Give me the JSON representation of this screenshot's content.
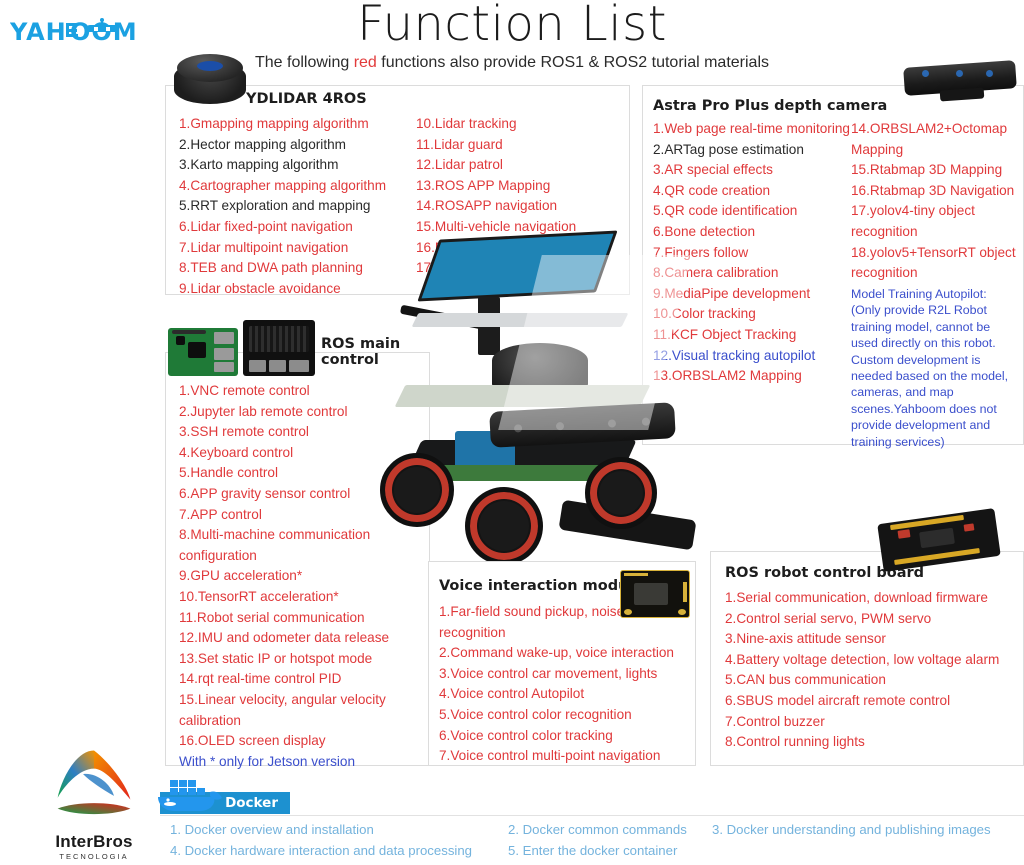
{
  "brand": {
    "logo_text": "YAHBOOM",
    "footer_logo_name": "InterBros",
    "footer_logo_sub": "TECNOLOGIA"
  },
  "header": {
    "title": "Function List",
    "subtitle_before": "The following ",
    "subtitle_highlight": "red",
    "subtitle_after": " functions also provide ROS1 & ROS2 tutorial materials",
    "highlight_color": "#e23b3b"
  },
  "colors": {
    "red": "#e0393b",
    "blue": "#3b4fcc",
    "docker_blue": "#1d91d0",
    "docker_text": "#74b3dd",
    "panel_border": "#dcdcdc"
  },
  "panels": {
    "lidar": {
      "title": "YDLIDAR 4ROS",
      "icon": "lidar-puck-photo",
      "column_left": [
        {
          "text": "1.Gmapping mapping algorithm",
          "color": "red"
        },
        {
          "text": "2.Hector mapping algorithm",
          "color": "black"
        },
        {
          "text": "3.Karto mapping algorithm",
          "color": "black"
        },
        {
          "text": "4.Cartographer mapping algorithm",
          "color": "red"
        },
        {
          "text": "5.RRT exploration and mapping",
          "color": "black"
        },
        {
          "text": "6.Lidar fixed-point navigation",
          "color": "red"
        },
        {
          "text": "7.Lidar multipoint navigation",
          "color": "red"
        },
        {
          "text": "8.TEB and DWA path planning",
          "color": "red"
        },
        {
          "text": "9.Lidar obstacle avoidance",
          "color": "red"
        }
      ],
      "column_right": [
        {
          "text": "10.Lidar tracking",
          "color": "red"
        },
        {
          "text": "11.Lidar guard",
          "color": "red"
        },
        {
          "text": "12.Lidar patrol",
          "color": "red"
        },
        {
          "text": "13.ROS APP Mapping",
          "color": "red"
        },
        {
          "text": "14.ROSAPP navigation",
          "color": "red"
        },
        {
          "text": "15.Multi-vehicle navigation",
          "color": "red"
        },
        {
          "text": "16.Multi-vehicle formation",
          "color": "red"
        },
        {
          "text": "17.Multi-vehicle surround",
          "color": "red"
        }
      ]
    },
    "camera": {
      "title": "Astra Pro Plus depth camera",
      "icon": "depth-camera-photo",
      "column_left": [
        {
          "text": "1.Web page real-time monitoring",
          "color": "red"
        },
        {
          "text": "2.ARTag pose estimation",
          "color": "black"
        },
        {
          "text": "3.AR special effects",
          "color": "red"
        },
        {
          "text": "4.QR code creation",
          "color": "red"
        },
        {
          "text": "5.QR code identification",
          "color": "red"
        },
        {
          "text": "6.Bone detection",
          "color": "red"
        },
        {
          "text": "7.Fingers follow",
          "color": "red"
        },
        {
          "text": "8.Camera calibration",
          "color": "red"
        },
        {
          "text": "9.MediaPipe development",
          "color": "red"
        },
        {
          "text": "10.Color tracking",
          "color": "red"
        },
        {
          "text": "11.KCF Object Tracking",
          "color": "red"
        },
        {
          "text": "12.Visual tracking autopilot",
          "color": "blue"
        },
        {
          "text": "13.ORBSLAM2 Mapping",
          "color": "red"
        }
      ],
      "column_right": [
        {
          "text": "14.ORBSLAM2+Octomap Mapping",
          "color": "red"
        },
        {
          "text": "15.Rtabmap 3D Mapping",
          "color": "red"
        },
        {
          "text": "16.Rtabmap 3D Navigation",
          "color": "red"
        },
        {
          "text": "17.yolov4-tiny object recognition",
          "color": "red"
        },
        {
          "text": "18.yolov5+TensorRT object recognition",
          "color": "red"
        }
      ],
      "note": "Model Training Autopilot: (Only provide R2L Robot training model, cannot be used directly on this robot. Custom development is needed based on the model, cameras, and map scenes.Yahboom does not provide development and training services)"
    },
    "main_control": {
      "title": "ROS main control",
      "icon_a": "raspberry-pi-board-photo",
      "icon_b": "jetson-board-photo",
      "items": [
        {
          "text": "1.VNC remote control",
          "color": "red"
        },
        {
          "text": "2.Jupyter lab remote control",
          "color": "red"
        },
        {
          "text": "3.SSH remote control",
          "color": "red"
        },
        {
          "text": "4.Keyboard control",
          "color": "red"
        },
        {
          "text": "5.Handle control",
          "color": "red"
        },
        {
          "text": "6.APP gravity sensor control",
          "color": "red"
        },
        {
          "text": "7.APP control",
          "color": "red"
        },
        {
          "text": "8.Multi-machine communication configuration",
          "color": "red"
        },
        {
          "text": "9.GPU acceleration*",
          "color": "red"
        },
        {
          "text": "10.TensorRT acceleration*",
          "color": "red"
        },
        {
          "text": "11.Robot serial communication",
          "color": "red"
        },
        {
          "text": "12.IMU and odometer data release",
          "color": "red"
        },
        {
          "text": "13.Set static IP or hotspot mode",
          "color": "red"
        },
        {
          "text": "14.rqt real-time control PID",
          "color": "red"
        },
        {
          "text": "15.Linear velocity, angular velocity calibration",
          "color": "red"
        },
        {
          "text": "16.OLED screen display",
          "color": "red"
        },
        {
          "text": "With * only for Jetson version",
          "color": "blue"
        }
      ]
    },
    "voice": {
      "title": "Voice interaction module",
      "icon": "voice-module-board-photo",
      "items": [
        {
          "text": "1.Far-field sound pickup, noise reduction recognition",
          "color": "red"
        },
        {
          "text": "2.Command wake-up, voice interaction",
          "color": "red"
        },
        {
          "text": "3.Voice control car movement, lights",
          "color": "red"
        },
        {
          "text": "4.Voice control Autopilot",
          "color": "red"
        },
        {
          "text": "5.Voice control color recognition",
          "color": "red"
        },
        {
          "text": "6.Voice control color tracking",
          "color": "red"
        },
        {
          "text": "7.Voice control multi-point navigation",
          "color": "red"
        }
      ]
    },
    "control_board": {
      "title": "ROS robot control board",
      "icon": "ros-control-board-photo",
      "items": [
        {
          "text": "1.Serial communication, download firmware",
          "color": "red"
        },
        {
          "text": "2.Control serial servo, PWM servo",
          "color": "red"
        },
        {
          "text": "3.Nine-axis attitude sensor",
          "color": "red"
        },
        {
          "text": "4.Battery voltage detection, low voltage alarm",
          "color": "red"
        },
        {
          "text": "5.CAN bus communication",
          "color": "red"
        },
        {
          "text": "6.SBUS model aircraft remote control",
          "color": "red"
        },
        {
          "text": "7.Control buzzer",
          "color": "red"
        },
        {
          "text": "8.Control running lights",
          "color": "red"
        }
      ]
    }
  },
  "docker": {
    "badge_label": "Docker",
    "icon": "docker-whale-icon",
    "items": [
      "1. Docker overview and installation",
      "2. Docker common commands",
      "3. Docker understanding and publishing images",
      "4.  Docker hardware interaction and data processing",
      "5.  Enter the docker container"
    ]
  },
  "robot_image": {
    "alt": "ROS robot car with lidar, depth camera and mecanum wheels"
  }
}
